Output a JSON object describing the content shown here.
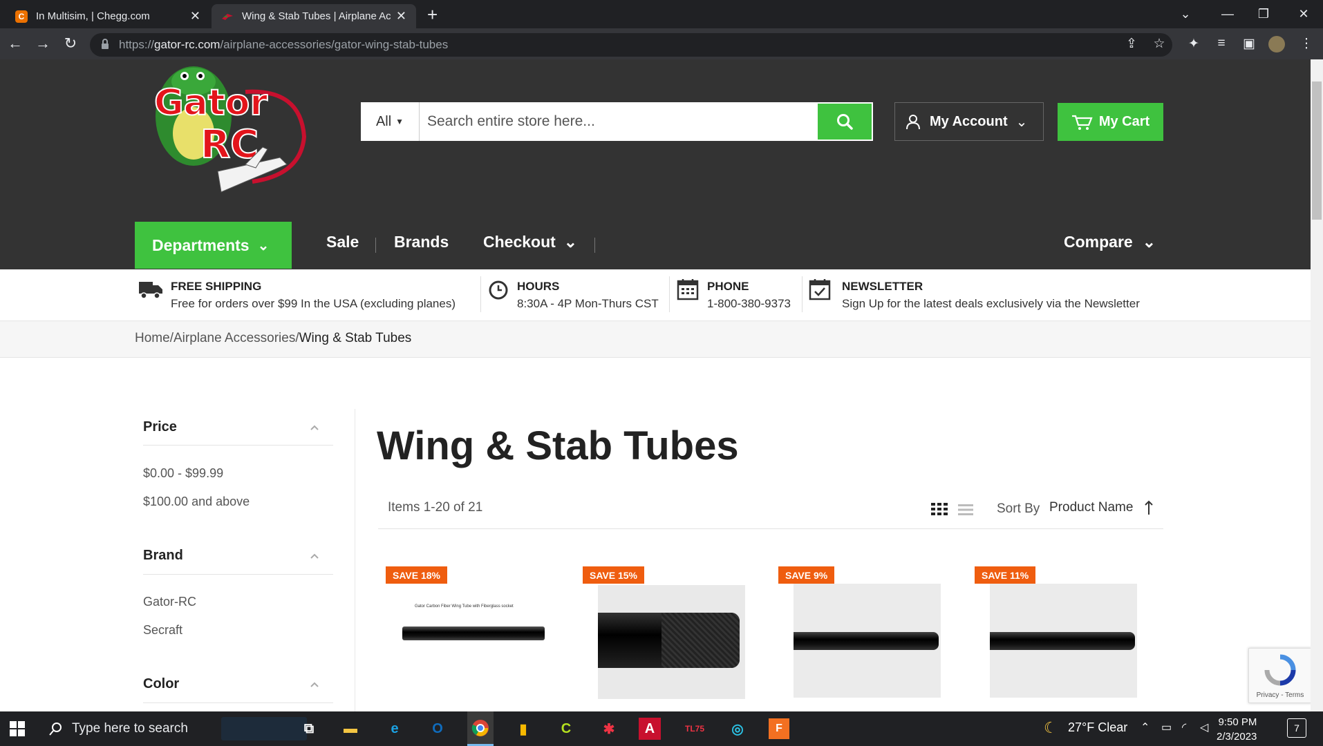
{
  "browser": {
    "tabs": [
      {
        "title": "In Multisim, | Chegg.com",
        "favicon": "chegg-icon",
        "favicon_letter": "C",
        "active": false
      },
      {
        "title": "Wing & Stab Tubes | Airplane Acc",
        "favicon": "gator-rc-icon",
        "active": true
      }
    ],
    "url_prefix": "https://",
    "url_host": "gator-rc.com",
    "url_path": "/airplane-accessories/gator-wing-stab-tubes"
  },
  "header": {
    "logo_text_top": "Gator",
    "logo_text_bottom": "RC",
    "search_category": "All",
    "search_placeholder": "Search entire store here...",
    "account_label": "My Account",
    "cart_label": "My Cart",
    "accent_color": "#3fc23f"
  },
  "nav": {
    "departments": "Departments",
    "sale": "Sale",
    "brands": "Brands",
    "checkout": "Checkout",
    "compare": "Compare"
  },
  "infobar": [
    {
      "icon": "truck-icon",
      "title": "FREE SHIPPING",
      "sub": "Free for orders over $99 In the USA (excluding planes)"
    },
    {
      "icon": "clock-icon",
      "title": "HOURS",
      "sub": "8:30A - 4P Mon-Thurs CST"
    },
    {
      "icon": "calendar-icon",
      "title": "PHONE",
      "sub": "1-800-380-9373"
    },
    {
      "icon": "calendar-check-icon",
      "title": "NEWSLETTER",
      "sub": "Sign Up for the latest deals exclusively via the Newsletter"
    }
  ],
  "breadcrumb": {
    "home": "Home",
    "sep": "/",
    "category": "Airplane Accessories",
    "current": "Wing & Stab Tubes"
  },
  "filters": {
    "price": {
      "title": "Price",
      "options": [
        "$0.00 - $99.99",
        "$100.00 and above"
      ]
    },
    "brand": {
      "title": "Brand",
      "options": [
        "Gator-RC",
        "Secraft"
      ]
    },
    "color": {
      "title": "Color"
    }
  },
  "main": {
    "title": "Wing & Stab Tubes",
    "items_count": "Items 1-20 of 21",
    "sort_label": "Sort By",
    "sort_value": "Product Name",
    "products": [
      {
        "badge": "SAVE 18%",
        "caption": "Gator Carbon Fiber Wing Tube with Fiberglass socket"
      },
      {
        "badge": "SAVE 15%"
      },
      {
        "badge": "SAVE 9%"
      },
      {
        "badge": "SAVE 11%"
      }
    ],
    "badge_color": "#ef5d0f"
  },
  "recaptcha": {
    "label": "Privacy - Terms"
  },
  "taskbar": {
    "search_placeholder": "Type here to search",
    "weather": "27°F  Clear",
    "time": "9:50 PM",
    "date": "2/3/2023",
    "notifications": "7"
  }
}
